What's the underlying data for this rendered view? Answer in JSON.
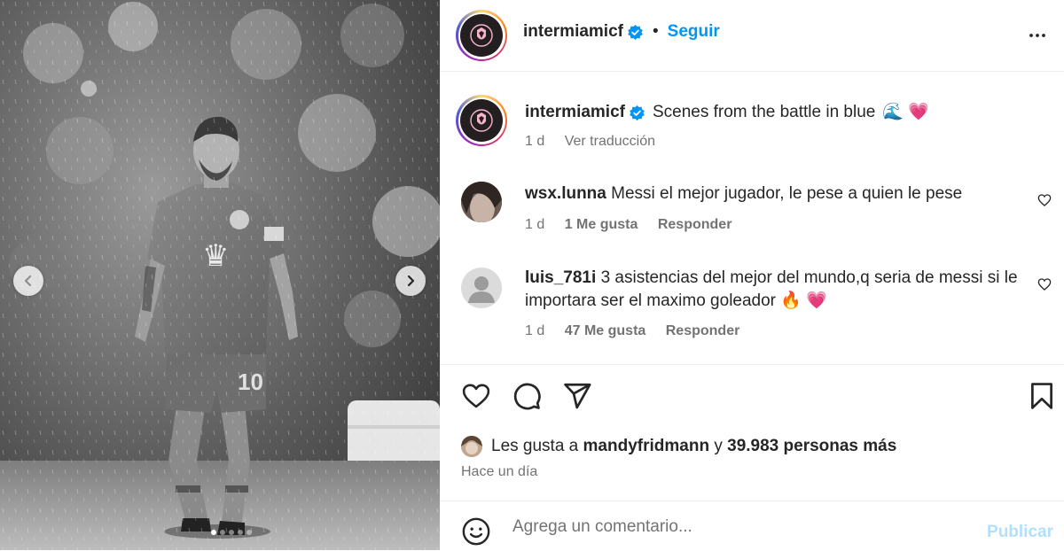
{
  "post": {
    "carousel": {
      "slide_count": 5,
      "active_slide": 1
    },
    "author": {
      "username": "intermiamicf",
      "verified": true,
      "follow_label": "Seguir"
    }
  },
  "caption": {
    "username": "intermiamicf",
    "text": "Scenes from the battle in blue",
    "emojis": "🌊 💗",
    "time": "1 d",
    "translate_label": "Ver traducción"
  },
  "comments": [
    {
      "username": "wsx.lunna",
      "text": "Messi el mejor jugador, le pese a quien le pese",
      "time": "1 d",
      "likes": "1 Me gusta",
      "reply_label": "Responder"
    },
    {
      "username": "luis_781i",
      "text": "3 asistencias del mejor del mundo,q seria de messi si le importara ser el maximo goleador",
      "emojis": "🔥 💗",
      "time": "1 d",
      "likes": "47 Me gusta",
      "reply_label": "Responder"
    }
  ],
  "likes_summary": {
    "prefix": "Les gusta a",
    "user": "mandyfridmann",
    "joiner": "y",
    "others": "39.983 personas más"
  },
  "post_time": "Hace un día",
  "composer": {
    "placeholder": "Agrega un comentario...",
    "publish_label": "Publicar"
  },
  "colors": {
    "accent": "#0095f6",
    "publish_disabled": "#b2dffc",
    "meta": "#737373"
  }
}
